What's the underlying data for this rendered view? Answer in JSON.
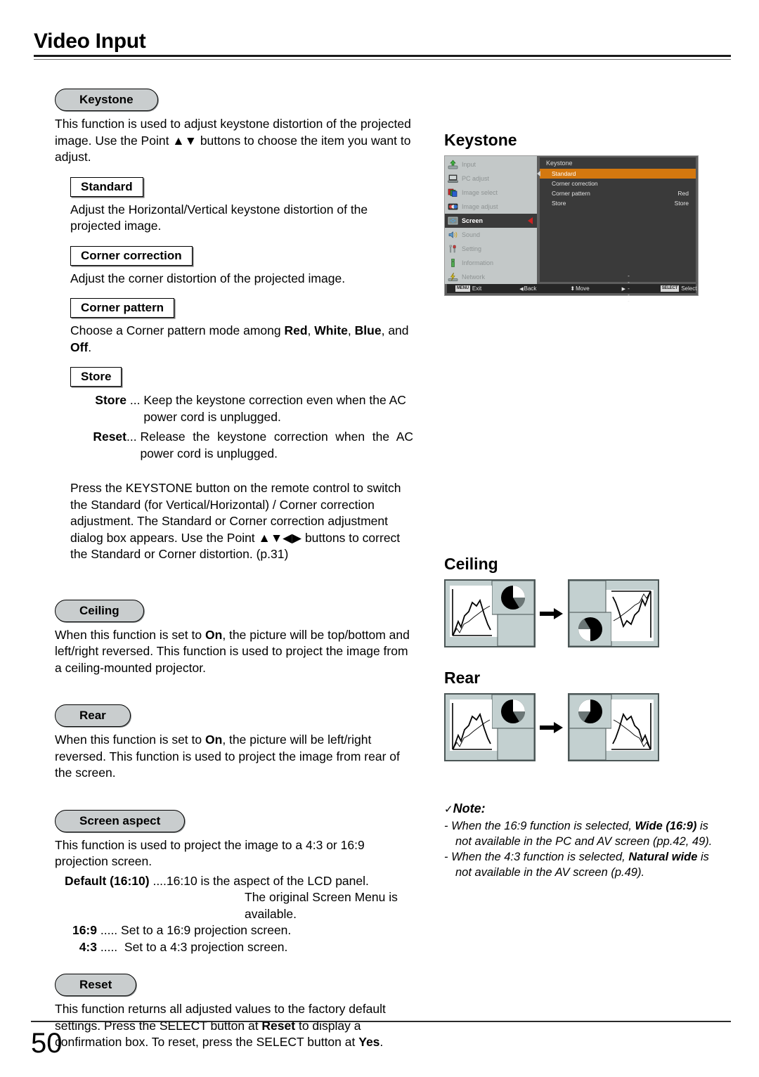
{
  "header": {
    "title": "Video Input"
  },
  "footer": {
    "page_number": "50"
  },
  "left": {
    "keystone": {
      "pill": "Keystone",
      "intro": "This function is used to adjust keystone distortion of the projected image. Use the Point ▲▼ buttons to choose the item you want to adjust.",
      "standard": {
        "heading": "Standard",
        "text": "Adjust the Horizontal/Vertical keystone distortion of the projected image."
      },
      "corner_correction": {
        "heading": "Corner correction",
        "text": "Adjust the corner distortion of the projected image."
      },
      "corner_pattern": {
        "heading": "Corner pattern",
        "text_1": "Choose a Corner pattern mode among ",
        "opt_red": "Red",
        "sep_1": ", ",
        "opt_white": "White",
        "sep_2": ", ",
        "opt_blue": "Blue",
        "sep_3": ", and ",
        "opt_off": "Off",
        "sep_4": "."
      },
      "store": {
        "heading": "Store",
        "rows": [
          {
            "term": "Store",
            "dots": " ... ",
            "desc": "Keep the keystone correction even when the AC power cord is unplugged."
          },
          {
            "term": "Reset",
            "dots": "... ",
            "desc": "Release the keystone correction when the AC power cord is unplugged."
          }
        ]
      },
      "remote_note": "Press the KEYSTONE button on the remote control to switch the Standard (for Vertical/Horizontal) / Corner correction adjustment. The Standard or Corner correction adjustment dialog box appears. Use the Point ▲▼◀▶ buttons to correct the Standard or Corner distortion.  (p.31)"
    },
    "ceiling": {
      "pill": "Ceiling",
      "text_1": "When this function is set to ",
      "bold_on": "On",
      "text_2": ", the picture will be top/bottom and left/right reversed. This function is used to project the image from a ceiling-mounted projector."
    },
    "rear": {
      "pill": "Rear",
      "text_1": "When this function is set to ",
      "bold_on": "On",
      "text_2": ", the picture will be left/right reversed. This function is used to project the image from rear of the screen."
    },
    "screen_aspect": {
      "pill": "Screen aspect",
      "text": "This function is used to project the image to a 4:3 or 16:9 projection screen.",
      "rows": [
        {
          "term": "Default (16:10)",
          "dots": " ....",
          "desc": "16:10 is the aspect of the LCD panel.",
          "desc2": "The original Screen Menu is available."
        },
        {
          "term": "16:9",
          "dots": " ..... ",
          "desc": "Set to a 16:9 projection screen.",
          "desc2": ""
        },
        {
          "term": "4:3",
          "dots": " .....  ",
          "desc": "Set to a 4:3 projection screen.",
          "desc2": ""
        }
      ]
    },
    "reset": {
      "pill": "Reset",
      "text_1": "This function returns all adjusted values to the factory default settings. Press the SELECT button at ",
      "bold_reset": "Reset",
      "text_2": " to display a confirmation box. To reset, press the SELECT button at ",
      "bold_yes": "Yes",
      "text_3": "."
    }
  },
  "right": {
    "keystone_fig": {
      "title": "Keystone",
      "osd": {
        "sidebar": [
          {
            "label": "Input",
            "icon": "input-icon",
            "active": false
          },
          {
            "label": "PC adjust",
            "icon": "pc-adjust-icon",
            "active": false
          },
          {
            "label": "Image select",
            "icon": "image-select-icon",
            "active": false
          },
          {
            "label": "Image adjust",
            "icon": "image-adjust-icon",
            "active": false
          },
          {
            "label": "Screen",
            "icon": "screen-icon",
            "active": true
          },
          {
            "label": "Sound",
            "icon": "sound-icon",
            "active": false
          },
          {
            "label": "Setting",
            "icon": "setting-icon",
            "active": false
          },
          {
            "label": "Information",
            "icon": "information-icon",
            "active": false
          },
          {
            "label": "Network",
            "icon": "network-icon",
            "active": false
          }
        ],
        "panel_title": "Keystone",
        "rows": [
          {
            "label": "Standard",
            "value": "",
            "selected": true
          },
          {
            "label": "Corner correction",
            "value": "",
            "selected": false
          },
          {
            "label": "Corner pattern",
            "value": "Red",
            "selected": false
          },
          {
            "label": "Store",
            "value": "Store",
            "selected": false
          }
        ],
        "statusbar": [
          {
            "key": "MENU",
            "label": "Exit"
          },
          {
            "key": "◀",
            "label": "Back"
          },
          {
            "key": "⬍",
            "label": "Move"
          },
          {
            "key": "▶",
            "label": "-----"
          },
          {
            "key": "SELECT",
            "label": "Select"
          }
        ],
        "highlight_color": "#d4780f"
      }
    },
    "ceiling_fig": {
      "title": "Ceiling"
    },
    "rear_fig": {
      "title": "Rear"
    },
    "note": {
      "title": "Note:",
      "check": "✓",
      "items": [
        {
          "pre": "- When the 16:9 function is selected, ",
          "bold": "Wide (16:9)",
          "post": " is not available in the PC and AV screen (pp.42, 49)."
        },
        {
          "pre": "- When the 4:3 function is selected, ",
          "bold": "Natural wide",
          "post": " is not available in the AV screen (p.49)."
        }
      ]
    }
  }
}
